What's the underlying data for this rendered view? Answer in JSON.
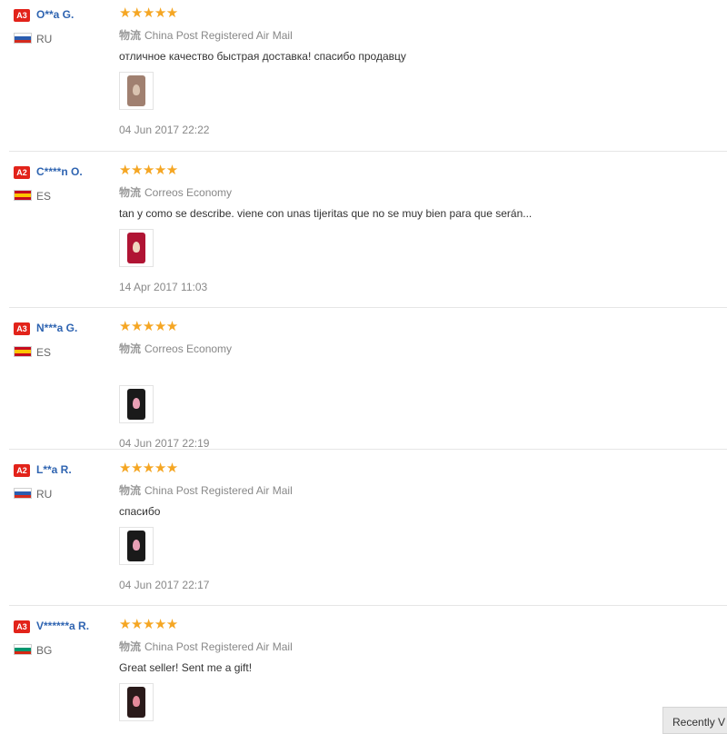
{
  "reviews": [
    {
      "badge": "A3",
      "name": "O**a G.",
      "country": "RU",
      "flag": "ru",
      "stars": "★★★★★",
      "ship_icon": "物流",
      "shipping": "China Post Registered Air Mail",
      "text": "отличное качество быстрая доставка! спасибо продавцу",
      "date": "04 Jun 2017 22:22",
      "thumb": "a"
    },
    {
      "badge": "A2",
      "name": "C****n O.",
      "country": "ES",
      "flag": "es",
      "stars": "★★★★★",
      "ship_icon": "物流",
      "shipping": "Correos Economy",
      "text": "tan y como se describe. viene con unas tijeritas que no se muy bien para que serán...",
      "date": "14 Apr 2017 11:03",
      "thumb": "b"
    },
    {
      "badge": "A3",
      "name": "N***a G.",
      "country": "ES",
      "flag": "es",
      "stars": "★★★★★",
      "ship_icon": "物流",
      "shipping": "Correos Economy",
      "text": "",
      "date": "04 Jun 2017 22:19",
      "thumb": "c"
    },
    {
      "badge": "A2",
      "name": "L**a R.",
      "country": "RU",
      "flag": "ru",
      "stars": "★★★★★",
      "ship_icon": "物流",
      "shipping": "China Post Registered Air Mail",
      "text": "спасибо",
      "date": "04 Jun 2017 22:17",
      "thumb": "c"
    },
    {
      "badge": "A3",
      "name": "V******a R.",
      "country": "BG",
      "flag": "bg",
      "stars": "★★★★★",
      "ship_icon": "物流",
      "shipping": "China Post Registered Air Mail",
      "text": "Great seller! Sent me a gift!",
      "date": "",
      "thumb": "d"
    }
  ],
  "rating_value": 5,
  "recently_label": "Recently V",
  "colors": {
    "name": "#2f64b1",
    "badge": "#e2231a",
    "star": "#f5a623"
  }
}
